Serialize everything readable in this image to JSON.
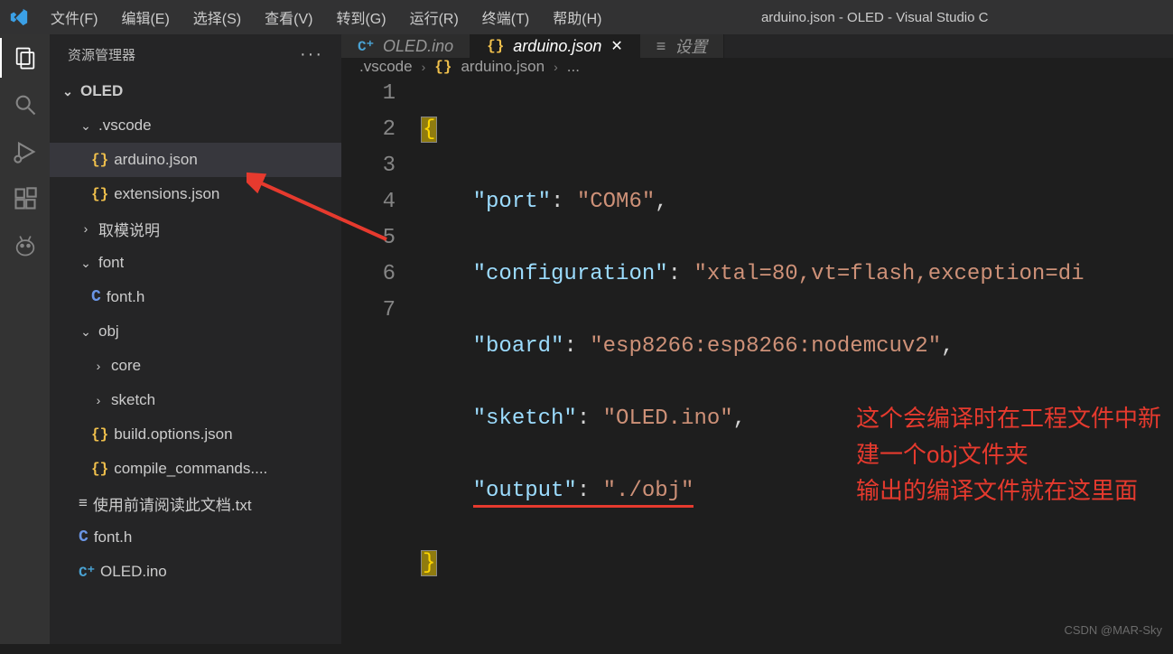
{
  "titlebar": {
    "menu": {
      "file": "文件(F)",
      "edit": "编辑(E)",
      "select": "选择(S)",
      "view": "查看(V)",
      "goto": "转到(G)",
      "run": "运行(R)",
      "terminal": "终端(T)",
      "help": "帮助(H)"
    },
    "title": "arduino.json - OLED - Visual Studio C"
  },
  "sidebar": {
    "header": "资源管理器",
    "root": "OLED",
    "vscode": ".vscode",
    "arduino_json": "arduino.json",
    "extensions_json": "extensions.json",
    "qumoshuo": "取模说明",
    "font": "font",
    "font_h": "font.h",
    "obj": "obj",
    "core": "core",
    "sketch": "sketch",
    "build_options": "build.options.json",
    "compile_commands": "compile_commands....",
    "readme": "使用前请阅读此文档.txt",
    "font_h2": "font.h",
    "oled_ino": "OLED.ino"
  },
  "tabs": {
    "oled_ino": "OLED.ino",
    "arduino_json": "arduino.json",
    "settings": "设置"
  },
  "breadcrumb": {
    "folder": ".vscode",
    "file": "arduino.json",
    "tail": "..."
  },
  "code": {
    "line_numbers": [
      "1",
      "2",
      "3",
      "4",
      "5",
      "6",
      "7"
    ],
    "brace_open": "{",
    "port_key": "\"port\"",
    "port_val": "\"COM6\"",
    "config_key": "\"configuration\"",
    "config_val": "\"xtal=80,vt=flash,exception=di",
    "board_key": "\"board\"",
    "board_val": "\"esp8266:esp8266:nodemcuv2\"",
    "sketch_key": "\"sketch\"",
    "sketch_val": "\"OLED.ino\"",
    "output_key": "\"output\"",
    "output_val": "\"./obj\"",
    "brace_close": "}",
    "colon": ":",
    "comma": ","
  },
  "annotation": {
    "line1": "这个会编译时在工程文件中新建一个obj文件夹",
    "line2": "输出的编译文件就在这里面"
  },
  "watermark": "CSDN @MAR-Sky"
}
